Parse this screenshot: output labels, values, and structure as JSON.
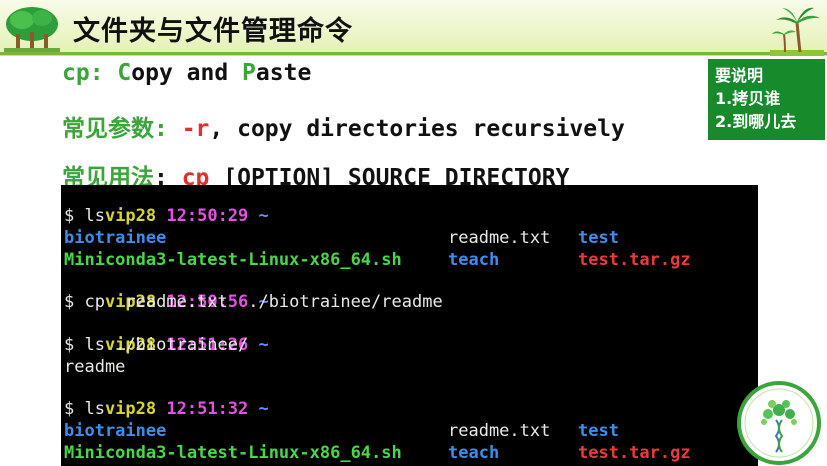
{
  "header": {
    "title": "文件夹与文件管理命令"
  },
  "lines": {
    "l1": {
      "cmd": "cp",
      "colon": ": ",
      "c": "C",
      "opy": "opy ",
      "and": "and ",
      "p": "P",
      "aste": "aste"
    },
    "l2": {
      "label": "常见参数",
      "colon": ": ",
      "flag": "-r",
      "rest": ", copy directories recursively"
    },
    "l3": {
      "label": "常见用法",
      "colon": ": ",
      "cmd": "cp",
      "rest": " [OPTION] SOURCE DIRECTORY"
    }
  },
  "note": {
    "title": "要说明",
    "item1": "1.拷贝谁",
    "item2": "2.到哪儿去"
  },
  "terminal": {
    "p1": {
      "user": "vip28",
      "time": "12:50:29",
      "tilde": "~"
    },
    "c1": "$ ls",
    "ls1": {
      "a": "biotrainee",
      "b": "readme.txt",
      "c": "test",
      "d": "Miniconda3-latest-Linux-x86_64.sh",
      "e": "teach",
      "f": "test.tar.gz"
    },
    "p2": {
      "user": "vip28",
      "time": "12:50:56",
      "tilde": "~"
    },
    "c2": "$ cp  readme.txt  ./biotrainee/readme",
    "p3": {
      "user": "vip28",
      "time": "12:51:26",
      "tilde": "~"
    },
    "c3": "$ ls ./biotrainee/",
    "out3": "readme",
    "p4": {
      "user": "vip28",
      "time": "12:51:32",
      "tilde": "~"
    },
    "c4": "$ ls",
    "ls2": {
      "a": "biotrainee",
      "b": "readme.txt",
      "c": "test",
      "d": "Miniconda3-latest-Linux-x86_64.sh",
      "e": "teach",
      "f": "test.tar.gz"
    }
  },
  "colors": {
    "green": "#3aa53a",
    "red": "#e0302a",
    "note_bg": "#178a2c",
    "terminal_bg": "#000000"
  },
  "icons": {
    "left_logo": "green-tree-logo-icon",
    "right_logo": "palm-tree-icon",
    "badge": "tree-dna-badge-icon"
  }
}
